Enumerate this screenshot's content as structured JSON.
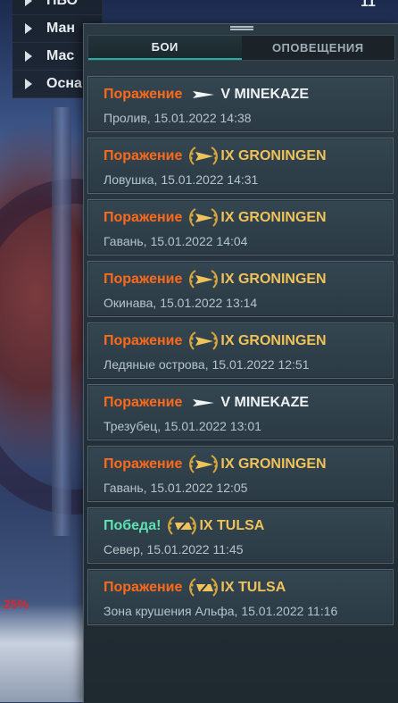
{
  "side_menu": {
    "items": [
      {
        "label": "ПВО"
      },
      {
        "label": "Ман"
      },
      {
        "label": "Мас"
      },
      {
        "label": "Осна"
      }
    ],
    "top_right_value": "11"
  },
  "background": {
    "percent_label": "25%"
  },
  "tabs": [
    {
      "label": "БОИ",
      "active": true
    },
    {
      "label": "ОПОВЕЩЕНИЯ",
      "active": false
    }
  ],
  "battles": [
    {
      "result": "Поражение",
      "outcome": "defeat",
      "icon": "destroyer-icon",
      "ship": "V MINEKAZE",
      "ship_style": "white",
      "details": "Пролив, 15.01.2022 14:38"
    },
    {
      "result": "Поражение",
      "outcome": "defeat",
      "icon": "special-destroyer-icon",
      "ship": "IX GRONINGEN",
      "ship_style": "gold",
      "details": "Ловушка, 15.01.2022 14:31"
    },
    {
      "result": "Поражение",
      "outcome": "defeat",
      "icon": "special-destroyer-icon",
      "ship": "IX GRONINGEN",
      "ship_style": "gold",
      "details": "Гавань, 15.01.2022 14:04"
    },
    {
      "result": "Поражение",
      "outcome": "defeat",
      "icon": "special-destroyer-icon",
      "ship": "IX GRONINGEN",
      "ship_style": "gold",
      "details": "Окинава, 15.01.2022 13:14"
    },
    {
      "result": "Поражение",
      "outcome": "defeat",
      "icon": "special-destroyer-icon",
      "ship": "IX GRONINGEN",
      "ship_style": "gold",
      "details": "Ледяные острова, 15.01.2022 12:51"
    },
    {
      "result": "Поражение",
      "outcome": "defeat",
      "icon": "destroyer-icon",
      "ship": "V MINEKAZE",
      "ship_style": "white",
      "details": "Трезубец, 15.01.2022 13:01"
    },
    {
      "result": "Поражение",
      "outcome": "defeat",
      "icon": "special-destroyer-icon",
      "ship": "IX GRONINGEN",
      "ship_style": "gold",
      "details": "Гавань, 15.01.2022 12:05"
    },
    {
      "result": "Победа!",
      "outcome": "victory",
      "icon": "special-cruiser-icon",
      "ship": "IX TULSA",
      "ship_style": "gold",
      "details": "Север, 15.01.2022 11:45"
    },
    {
      "result": "Поражение",
      "outcome": "defeat",
      "icon": "special-cruiser-icon",
      "ship": "IX TULSA",
      "ship_style": "gold",
      "details": "Зона крушения Альфа, 15.01.2022 11:16"
    }
  ],
  "colors": {
    "defeat": "#ff6a1a",
    "victory": "#5ee1b3",
    "gold": "#f0c25a",
    "tab_accent": "#1eb2a6"
  }
}
